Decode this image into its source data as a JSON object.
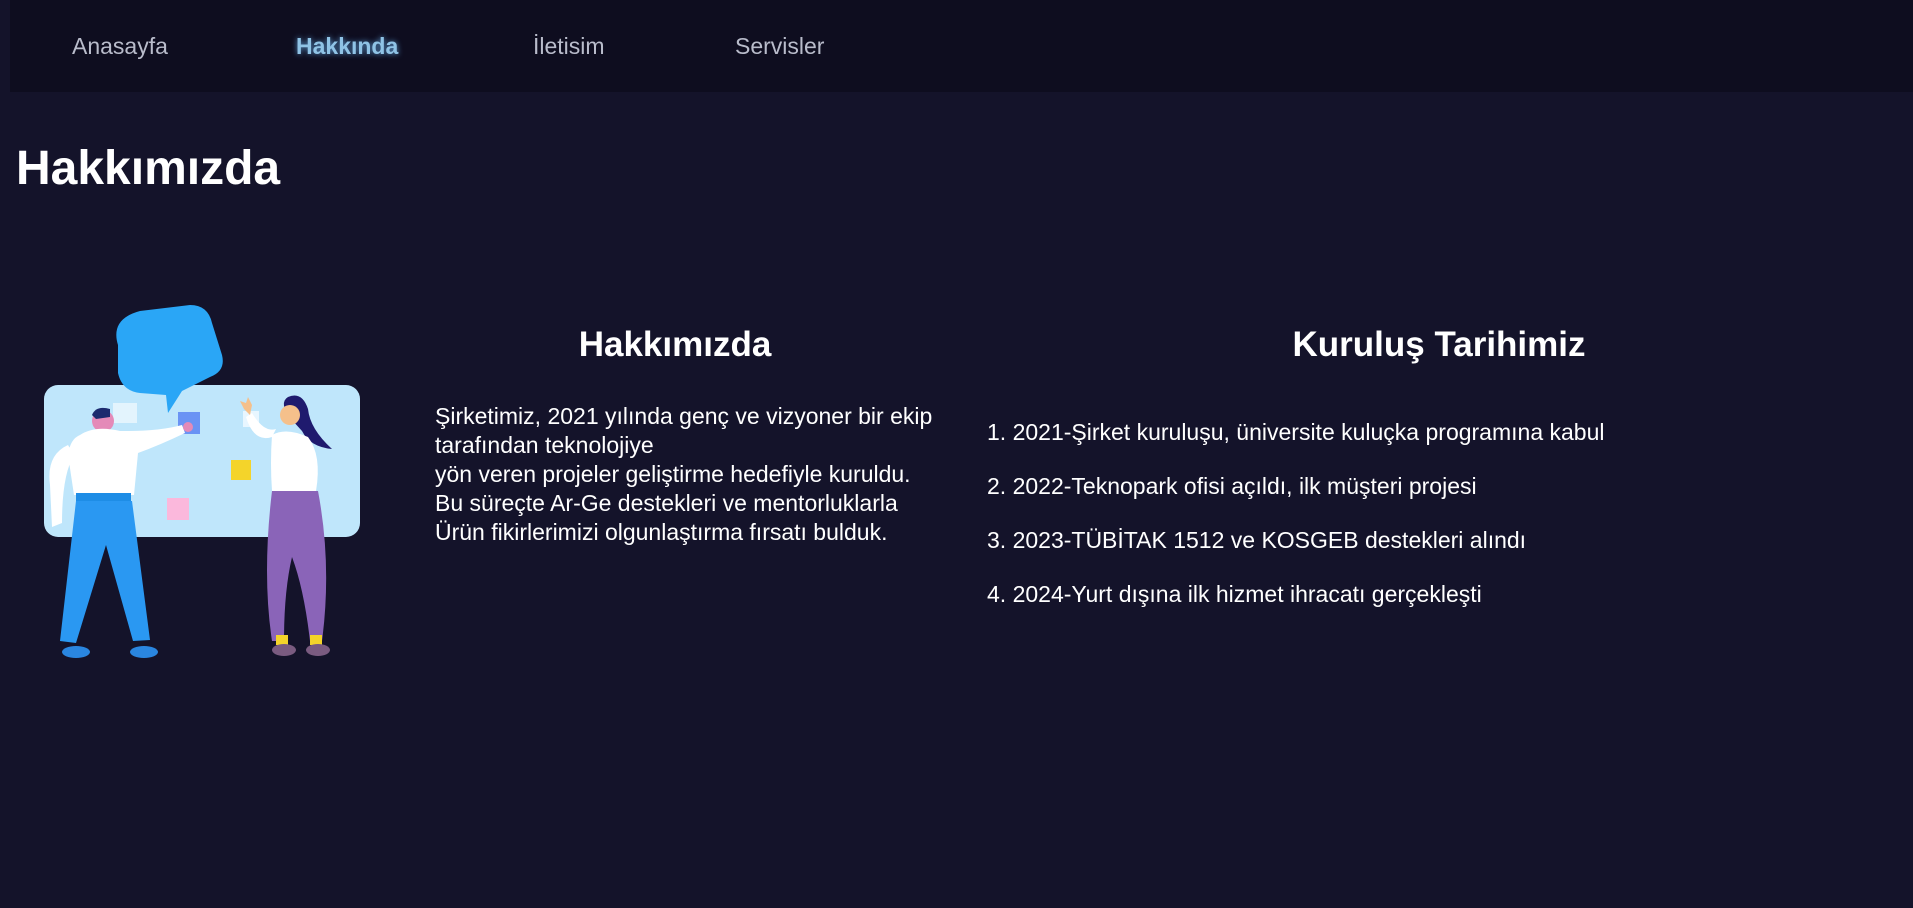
{
  "nav": {
    "items": [
      {
        "label": "Anasayfa"
      },
      {
        "label": "Hakkında",
        "active": true
      },
      {
        "label": "İletisim"
      },
      {
        "label": "Servisler"
      }
    ]
  },
  "page": {
    "title": "Hakkımızda"
  },
  "about": {
    "heading": "Hakkımızda",
    "lines": [
      "Şirketimiz, 2021 yılında genç ve vizyoner bir ekip tarafından teknolojiye",
      "yön veren projeler geliştirme hedefiyle kuruldu.",
      "Bu süreçte Ar-Ge destekleri ve mentorluklarla",
      "Ürün fikirlerimizi olgunlaştırma fırsatı bulduk."
    ]
  },
  "history": {
    "heading": "Kuruluş Tarihimiz",
    "items": [
      "1. 2021-Şirket kuruluşu, üniversite kuluçka programına kabul",
      "2. 2022-Teknopark ofisi açıldı, ilk müşteri projesi",
      "3. 2023-TÜBİTAK 1512 ve KOSGEB destekleri alındı",
      "4. 2024-Yurt dışına ilk hizmet ihracatı gerçekleşti"
    ]
  },
  "colors": {
    "background": "#14132a",
    "navbar": "#0e0d1f",
    "active_link": "#8fc3e6",
    "illustration_blue": "#2aa6f6",
    "illustration_purple": "#8a64b8"
  }
}
